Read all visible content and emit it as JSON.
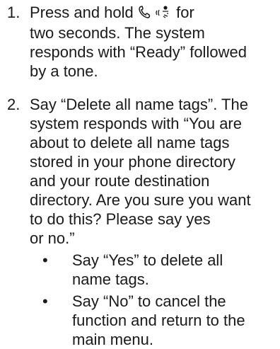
{
  "steps": [
    {
      "number": "1.",
      "text_before_icons": "Press and hold ",
      "icon_phone": "phone-handset-icon",
      "icon_voice": "voice-recognition-icon",
      "line1_after": " for",
      "line2": "two seconds. The system",
      "line3": "responds with “Ready” followed",
      "line4": "by a tone."
    },
    {
      "number": "2.",
      "line1": "Say “Delete all name tags”. The",
      "line2": "system responds with “You are",
      "line3": "about to delete all name tags",
      "line4": "stored in your phone directory",
      "line5": "and your route destination",
      "line6": "directory. Are you sure you want",
      "line7": "to do this? Please say yes",
      "line8": "or no.”"
    }
  ],
  "bullets": [
    {
      "dot": "•",
      "line1": "Say “Yes” to delete all",
      "line2": "name tags."
    },
    {
      "dot": "•",
      "line1": "Say “No” to cancel the",
      "line2": "function and return to the",
      "line3": "main menu."
    }
  ]
}
